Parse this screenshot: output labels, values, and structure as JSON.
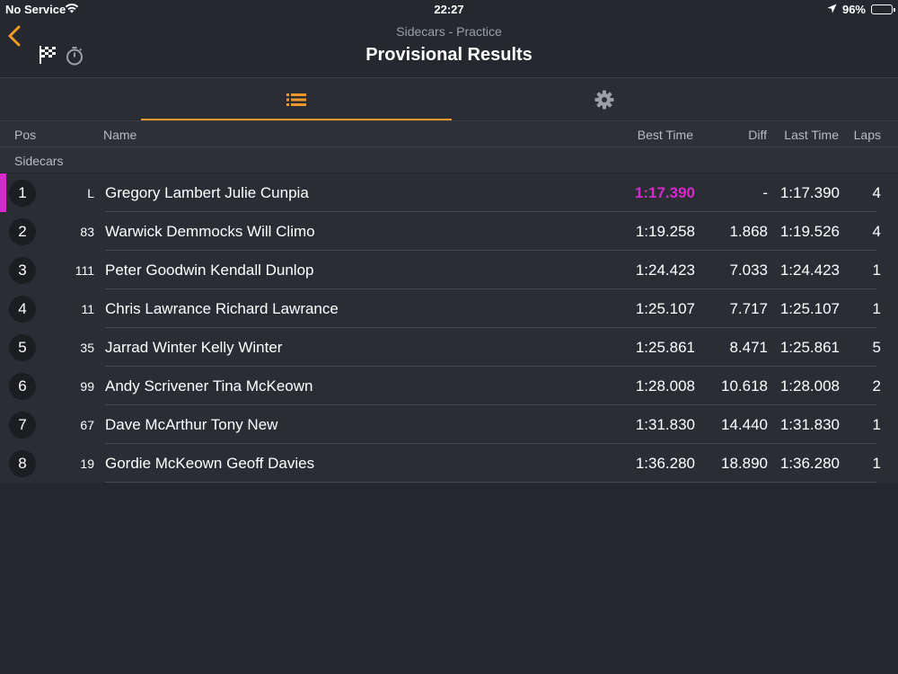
{
  "status_bar": {
    "carrier": "No Service",
    "time": "22:27",
    "battery": "96%",
    "battery_level": 0.96
  },
  "header": {
    "back_icon": "chevron-left-icon",
    "subtitle": "Sidecars - Practice",
    "title": "Provisional Results",
    "icons": [
      "checkered-flag-icon",
      "stopwatch-icon"
    ]
  },
  "tabs": [
    {
      "icon": "list-icon",
      "active": true
    },
    {
      "icon": "gear-icon",
      "active": false
    }
  ],
  "columns": {
    "pos": "Pos",
    "name": "Name",
    "best_time": "Best Time",
    "diff": "Diff",
    "last_time": "Last Time",
    "laps": "Laps"
  },
  "group_label": "Sidecars",
  "colors": {
    "accent": "#f0982a",
    "leader": "#d629cf",
    "background": "#25282e"
  },
  "results": [
    {
      "pos": "1",
      "num": "L",
      "name": "Gregory Lambert Julie Cunpia",
      "best": "1:17.390",
      "diff": "-",
      "last": "1:17.390",
      "laps": "4",
      "leader": true
    },
    {
      "pos": "2",
      "num": "83",
      "name": "Warwick Demmocks Will Climo",
      "best": "1:19.258",
      "diff": "1.868",
      "last": "1:19.526",
      "laps": "4",
      "leader": false
    },
    {
      "pos": "3",
      "num": "111",
      "name": "Peter Goodwin Kendall Dunlop",
      "best": "1:24.423",
      "diff": "7.033",
      "last": "1:24.423",
      "laps": "1",
      "leader": false
    },
    {
      "pos": "4",
      "num": "11",
      "name": "Chris Lawrance Richard Lawrance",
      "best": "1:25.107",
      "diff": "7.717",
      "last": "1:25.107",
      "laps": "1",
      "leader": false
    },
    {
      "pos": "5",
      "num": "35",
      "name": "Jarrad Winter Kelly Winter",
      "best": "1:25.861",
      "diff": "8.471",
      "last": "1:25.861",
      "laps": "5",
      "leader": false
    },
    {
      "pos": "6",
      "num": "99",
      "name": "Andy Scrivener Tina McKeown",
      "best": "1:28.008",
      "diff": "10.618",
      "last": "1:28.008",
      "laps": "2",
      "leader": false
    },
    {
      "pos": "7",
      "num": "67",
      "name": "Dave McArthur Tony New",
      "best": "1:31.830",
      "diff": "14.440",
      "last": "1:31.830",
      "laps": "1",
      "leader": false
    },
    {
      "pos": "8",
      "num": "19",
      "name": "Gordie McKeown Geoff Davies",
      "best": "1:36.280",
      "diff": "18.890",
      "last": "1:36.280",
      "laps": "1",
      "leader": false
    }
  ]
}
